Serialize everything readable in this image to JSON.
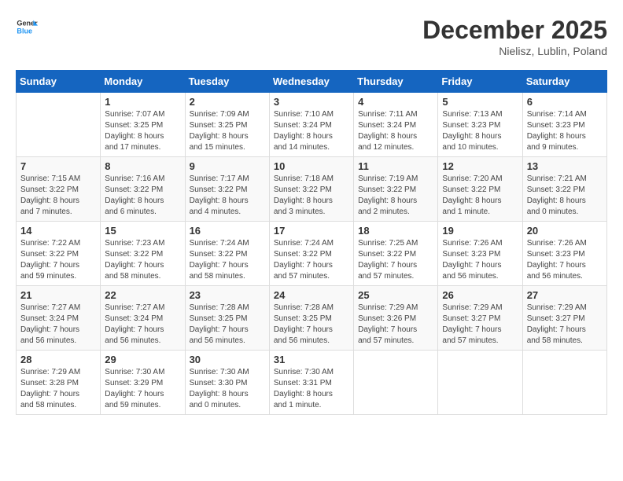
{
  "header": {
    "logo_line1": "General",
    "logo_line2": "Blue",
    "month": "December 2025",
    "location": "Nielisz, Lublin, Poland"
  },
  "weekdays": [
    "Sunday",
    "Monday",
    "Tuesday",
    "Wednesday",
    "Thursday",
    "Friday",
    "Saturday"
  ],
  "weeks": [
    [
      {
        "day": "",
        "info": ""
      },
      {
        "day": "1",
        "info": "Sunrise: 7:07 AM\nSunset: 3:25 PM\nDaylight: 8 hours\nand 17 minutes."
      },
      {
        "day": "2",
        "info": "Sunrise: 7:09 AM\nSunset: 3:25 PM\nDaylight: 8 hours\nand 15 minutes."
      },
      {
        "day": "3",
        "info": "Sunrise: 7:10 AM\nSunset: 3:24 PM\nDaylight: 8 hours\nand 14 minutes."
      },
      {
        "day": "4",
        "info": "Sunrise: 7:11 AM\nSunset: 3:24 PM\nDaylight: 8 hours\nand 12 minutes."
      },
      {
        "day": "5",
        "info": "Sunrise: 7:13 AM\nSunset: 3:23 PM\nDaylight: 8 hours\nand 10 minutes."
      },
      {
        "day": "6",
        "info": "Sunrise: 7:14 AM\nSunset: 3:23 PM\nDaylight: 8 hours\nand 9 minutes."
      }
    ],
    [
      {
        "day": "7",
        "info": "Sunrise: 7:15 AM\nSunset: 3:22 PM\nDaylight: 8 hours\nand 7 minutes."
      },
      {
        "day": "8",
        "info": "Sunrise: 7:16 AM\nSunset: 3:22 PM\nDaylight: 8 hours\nand 6 minutes."
      },
      {
        "day": "9",
        "info": "Sunrise: 7:17 AM\nSunset: 3:22 PM\nDaylight: 8 hours\nand 4 minutes."
      },
      {
        "day": "10",
        "info": "Sunrise: 7:18 AM\nSunset: 3:22 PM\nDaylight: 8 hours\nand 3 minutes."
      },
      {
        "day": "11",
        "info": "Sunrise: 7:19 AM\nSunset: 3:22 PM\nDaylight: 8 hours\nand 2 minutes."
      },
      {
        "day": "12",
        "info": "Sunrise: 7:20 AM\nSunset: 3:22 PM\nDaylight: 8 hours\nand 1 minute."
      },
      {
        "day": "13",
        "info": "Sunrise: 7:21 AM\nSunset: 3:22 PM\nDaylight: 8 hours\nand 0 minutes."
      }
    ],
    [
      {
        "day": "14",
        "info": "Sunrise: 7:22 AM\nSunset: 3:22 PM\nDaylight: 7 hours\nand 59 minutes."
      },
      {
        "day": "15",
        "info": "Sunrise: 7:23 AM\nSunset: 3:22 PM\nDaylight: 7 hours\nand 58 minutes."
      },
      {
        "day": "16",
        "info": "Sunrise: 7:24 AM\nSunset: 3:22 PM\nDaylight: 7 hours\nand 58 minutes."
      },
      {
        "day": "17",
        "info": "Sunrise: 7:24 AM\nSunset: 3:22 PM\nDaylight: 7 hours\nand 57 minutes."
      },
      {
        "day": "18",
        "info": "Sunrise: 7:25 AM\nSunset: 3:22 PM\nDaylight: 7 hours\nand 57 minutes."
      },
      {
        "day": "19",
        "info": "Sunrise: 7:26 AM\nSunset: 3:23 PM\nDaylight: 7 hours\nand 56 minutes."
      },
      {
        "day": "20",
        "info": "Sunrise: 7:26 AM\nSunset: 3:23 PM\nDaylight: 7 hours\nand 56 minutes."
      }
    ],
    [
      {
        "day": "21",
        "info": "Sunrise: 7:27 AM\nSunset: 3:24 PM\nDaylight: 7 hours\nand 56 minutes."
      },
      {
        "day": "22",
        "info": "Sunrise: 7:27 AM\nSunset: 3:24 PM\nDaylight: 7 hours\nand 56 minutes."
      },
      {
        "day": "23",
        "info": "Sunrise: 7:28 AM\nSunset: 3:25 PM\nDaylight: 7 hours\nand 56 minutes."
      },
      {
        "day": "24",
        "info": "Sunrise: 7:28 AM\nSunset: 3:25 PM\nDaylight: 7 hours\nand 56 minutes."
      },
      {
        "day": "25",
        "info": "Sunrise: 7:29 AM\nSunset: 3:26 PM\nDaylight: 7 hours\nand 57 minutes."
      },
      {
        "day": "26",
        "info": "Sunrise: 7:29 AM\nSunset: 3:27 PM\nDaylight: 7 hours\nand 57 minutes."
      },
      {
        "day": "27",
        "info": "Sunrise: 7:29 AM\nSunset: 3:27 PM\nDaylight: 7 hours\nand 58 minutes."
      }
    ],
    [
      {
        "day": "28",
        "info": "Sunrise: 7:29 AM\nSunset: 3:28 PM\nDaylight: 7 hours\nand 58 minutes."
      },
      {
        "day": "29",
        "info": "Sunrise: 7:30 AM\nSunset: 3:29 PM\nDaylight: 7 hours\nand 59 minutes."
      },
      {
        "day": "30",
        "info": "Sunrise: 7:30 AM\nSunset: 3:30 PM\nDaylight: 8 hours\nand 0 minutes."
      },
      {
        "day": "31",
        "info": "Sunrise: 7:30 AM\nSunset: 3:31 PM\nDaylight: 8 hours\nand 1 minute."
      },
      {
        "day": "",
        "info": ""
      },
      {
        "day": "",
        "info": ""
      },
      {
        "day": "",
        "info": ""
      }
    ]
  ]
}
